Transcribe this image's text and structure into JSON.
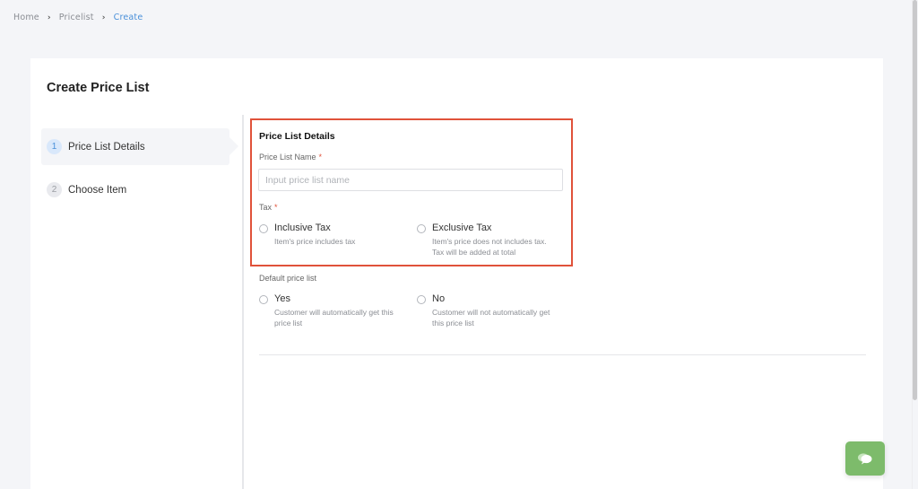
{
  "breadcrumb": [
    {
      "label": "Home"
    },
    {
      "label": "Pricelist"
    },
    {
      "label": "Create",
      "active": true
    }
  ],
  "page": {
    "title": "Create Price List"
  },
  "steps": [
    {
      "number": "1",
      "label": "Price List Details",
      "active": true
    },
    {
      "number": "2",
      "label": "Choose Item",
      "active": false
    }
  ],
  "form": {
    "section_title": "Price List Details",
    "name_field": {
      "label": "Price List Name",
      "required_mark": "*",
      "value": "",
      "placeholder": "Input price list name"
    },
    "tax": {
      "label": "Tax",
      "required_mark": "*",
      "options": [
        {
          "title": "Inclusive Tax",
          "description": "Item's price includes tax",
          "selected": false
        },
        {
          "title": "Exclusive Tax",
          "description": "Item's price does not includes tax. Tax will be added at total",
          "selected": false
        }
      ]
    },
    "default_price_list": {
      "label": "Default price list",
      "options": [
        {
          "title": "Yes",
          "description": "Customer will automatically get this price list",
          "selected": false
        },
        {
          "title": "No",
          "description": "Customer will not automatically get this price list",
          "selected": false
        }
      ]
    }
  },
  "chat_button": {
    "icon": "chat-bubble-icon"
  },
  "colors": {
    "accent": "#4a90d9",
    "highlight_border": "#e0523a",
    "chat_button": "#7dbb6b",
    "background": "#f4f5f8"
  }
}
